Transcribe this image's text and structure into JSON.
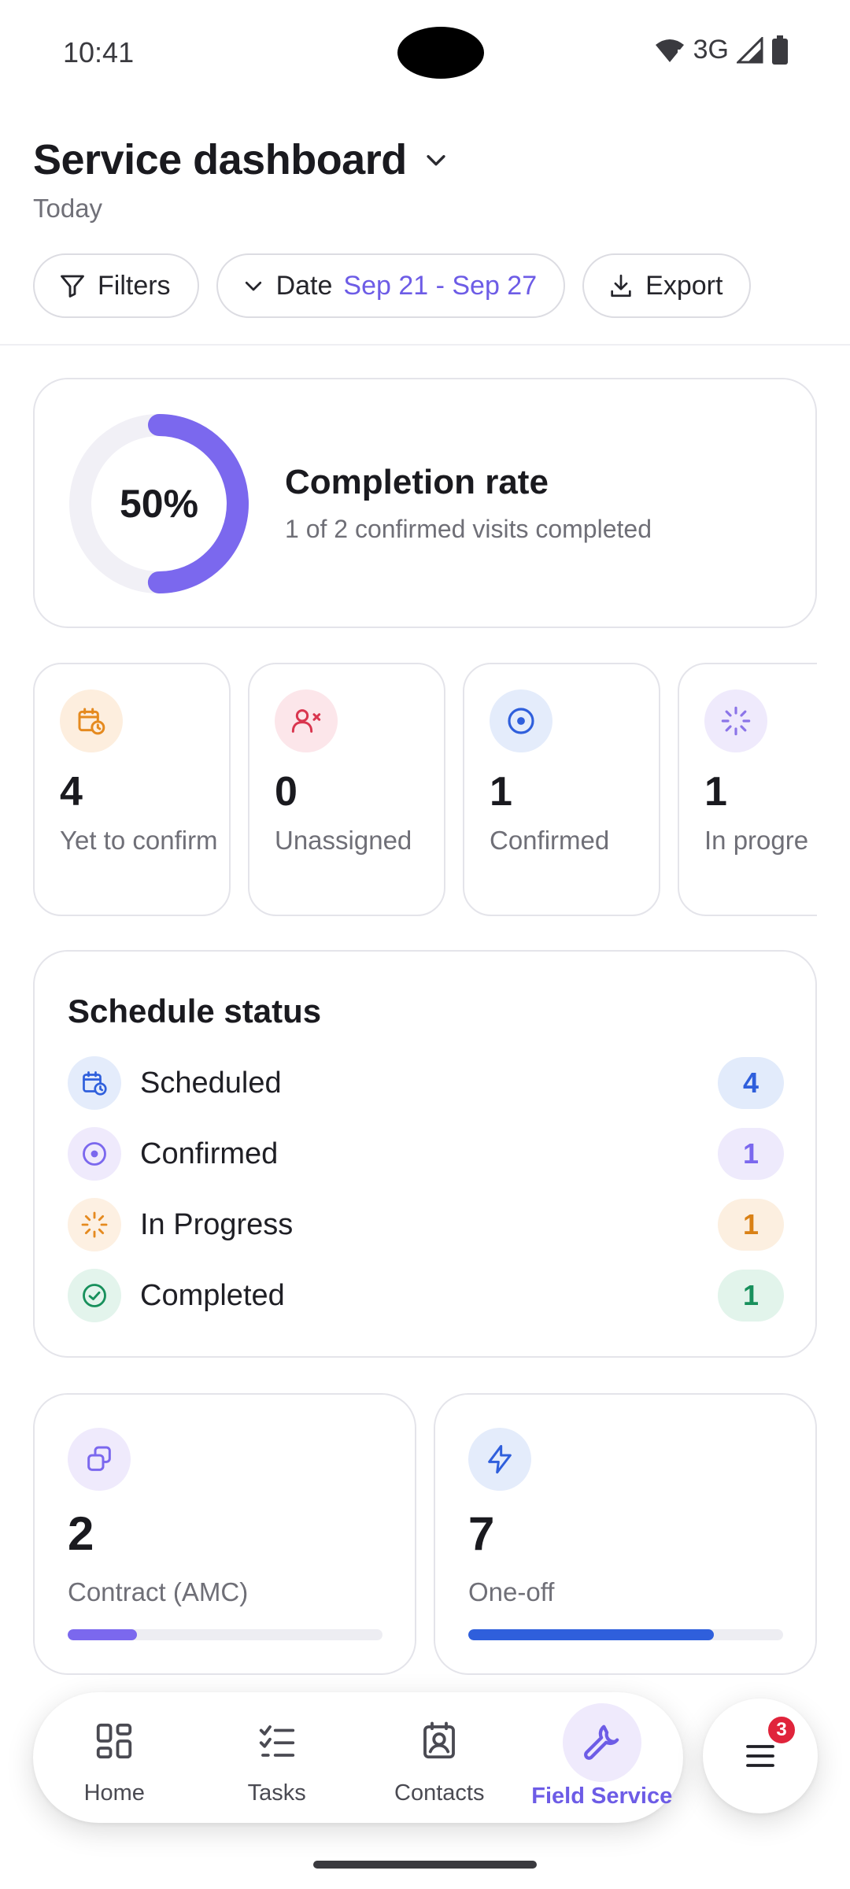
{
  "status_bar": {
    "time": "10:41",
    "network": "3G"
  },
  "header": {
    "title": "Service dashboard",
    "subtitle": "Today"
  },
  "filters": {
    "filters_label": "Filters",
    "date_label": "Date",
    "date_range": "Sep 21 - Sep 27",
    "export_label": "Export"
  },
  "completion": {
    "percent_label": "50%",
    "percent_value": 0.5,
    "title": "Completion rate",
    "subtitle": "1 of 2 confirmed visits completed",
    "ring_color": "#7b68ee"
  },
  "stats": [
    {
      "value": "4",
      "label": "Yet to confirm",
      "icon": "calendar-clock-icon"
    },
    {
      "value": "0",
      "label": "Unassigned",
      "icon": "user-x-icon"
    },
    {
      "value": "1",
      "label": "Confirmed",
      "icon": "target-circle-icon"
    },
    {
      "value": "1",
      "label": "In progre",
      "icon": "loader-icon"
    }
  ],
  "schedule": {
    "title": "Schedule status",
    "rows": [
      {
        "label": "Scheduled",
        "count": "4",
        "icon": "calendar-clock-icon"
      },
      {
        "label": "Confirmed",
        "count": "1",
        "icon": "target-circle-icon"
      },
      {
        "label": "In Progress",
        "count": "1",
        "icon": "loader-icon"
      },
      {
        "label": "Completed",
        "count": "1",
        "icon": "check-circle-icon"
      }
    ]
  },
  "types": [
    {
      "value": "2",
      "label": "Contract (AMC)",
      "progress": 0.22,
      "color": "#7b68ee",
      "icon": "copy-icon"
    },
    {
      "value": "7",
      "label": "One-off",
      "progress": 0.78,
      "color": "#2f5fdc",
      "icon": "zap-icon"
    }
  ],
  "nav": {
    "items": [
      {
        "label": "Home",
        "icon": "grid-icon"
      },
      {
        "label": "Tasks",
        "icon": "checklist-icon"
      },
      {
        "label": "Contacts",
        "icon": "contact-badge-icon"
      },
      {
        "label": "Field Service",
        "icon": "wrench-icon",
        "active": true
      }
    ],
    "menu_badge": "3"
  },
  "colors": {
    "accent": "#6d5ce6",
    "orange": "#e58a1f",
    "red": "#d9364f",
    "blue": "#2f5fdc",
    "green": "#18905c"
  }
}
